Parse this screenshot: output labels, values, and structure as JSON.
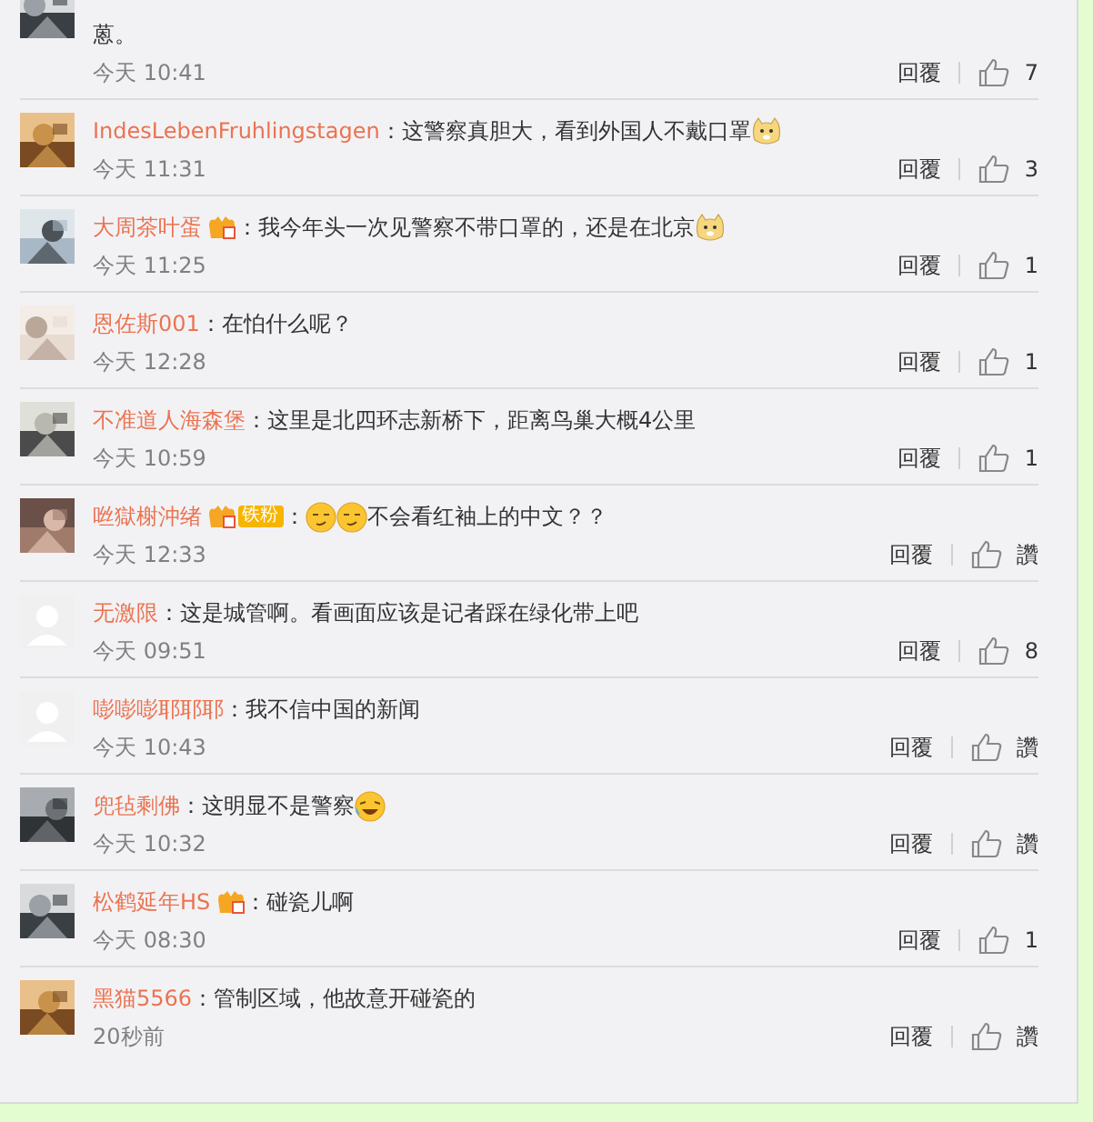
{
  "comments": [
    {
      "avatar": {
        "kind": "picture"
      },
      "content": [
        {
          "kind": "text",
          "text": "蒽。"
        }
      ],
      "time": "今天 10:41",
      "reply": "回覆",
      "likes": "7"
    },
    {
      "avatar": {
        "kind": "picture"
      },
      "name": "IndesLebenFruhlingstagen",
      "content": [
        {
          "kind": "text",
          "text": "：这警察真胆大，看到外国人不戴口罩"
        },
        {
          "kind": "dog"
        }
      ],
      "time": "今天 11:31",
      "reply": "回覆",
      "likes": "3"
    },
    {
      "avatar": {
        "kind": "picture"
      },
      "name": "大周茶叶蛋",
      "badges": [
        {
          "kind": "vip"
        }
      ],
      "content": [
        {
          "kind": "text",
          "text": "：我今年头一次见警察不带口罩的，还是在北京"
        },
        {
          "kind": "dog"
        }
      ],
      "time": "今天 11:25",
      "reply": "回覆",
      "likes": "1"
    },
    {
      "avatar": {
        "kind": "picture"
      },
      "name": "恩佐斯001",
      "content": [
        {
          "kind": "text",
          "text": "：在怕什么呢？"
        }
      ],
      "time": "今天 12:28",
      "reply": "回覆",
      "likes": "1"
    },
    {
      "avatar": {
        "kind": "picture"
      },
      "name": "不准道人海森堡",
      "content": [
        {
          "kind": "text",
          "text": "：这里是北四环志新桥下，距离鸟巢大概4公里"
        }
      ],
      "time": "今天 10:59",
      "reply": "回覆",
      "likes": "1"
    },
    {
      "avatar": {
        "kind": "picture"
      },
      "name": "咝獄榭沖绪",
      "badges": [
        {
          "kind": "vip"
        },
        {
          "kind": "fan",
          "label": "铁粉"
        }
      ],
      "content": [
        {
          "kind": "text",
          "text": "："
        },
        {
          "kind": "sly"
        },
        {
          "kind": "sly"
        },
        {
          "kind": "text",
          "text": "不会看红袖上的中文？？"
        }
      ],
      "time": "今天 12:33",
      "reply": "回覆",
      "likes": "讚"
    },
    {
      "avatar": {
        "kind": "default"
      },
      "name": "无激限",
      "content": [
        {
          "kind": "text",
          "text": "：这是城管啊。看画面应该是记者踩在绿化带上吧"
        }
      ],
      "time": "今天 09:51",
      "reply": "回覆",
      "likes": "8"
    },
    {
      "avatar": {
        "kind": "default"
      },
      "name": "嘭嘭嘭耶耶耶",
      "content": [
        {
          "kind": "text",
          "text": "：我不信中国的新闻"
        }
      ],
      "time": "今天 10:43",
      "reply": "回覆",
      "likes": "讚"
    },
    {
      "avatar": {
        "kind": "picture"
      },
      "name": "兜毡剩佛",
      "content": [
        {
          "kind": "text",
          "text": "：这明显不是警察"
        },
        {
          "kind": "laugh"
        }
      ],
      "time": "今天 10:32",
      "reply": "回覆",
      "likes": "讚"
    },
    {
      "avatar": {
        "kind": "picture"
      },
      "name": "松鹤延年HS",
      "badges": [
        {
          "kind": "vip"
        }
      ],
      "content": [
        {
          "kind": "text",
          "text": "：碰瓷儿啊"
        }
      ],
      "time": "今天 08:30",
      "reply": "回覆",
      "likes": "1"
    },
    {
      "avatar": {
        "kind": "picture"
      },
      "name": "黑猫5566",
      "content": [
        {
          "kind": "text",
          "text": "：管制区域，他故意开碰瓷的"
        }
      ],
      "time": "20秒前",
      "reply": "回覆",
      "likes": "讚"
    }
  ]
}
